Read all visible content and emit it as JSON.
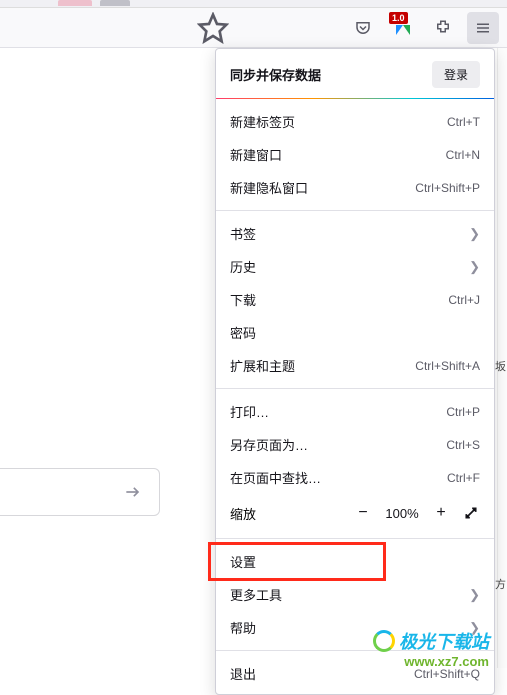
{
  "toolbar": {
    "badge_text": "1.0"
  },
  "menu": {
    "sync_title": "同步并保存数据",
    "login_label": "登录",
    "new_tab": {
      "label": "新建标签页",
      "shortcut": "Ctrl+T"
    },
    "new_window": {
      "label": "新建窗口",
      "shortcut": "Ctrl+N"
    },
    "new_private": {
      "label": "新建隐私窗口",
      "shortcut": "Ctrl+Shift+P"
    },
    "bookmarks": {
      "label": "书签"
    },
    "history": {
      "label": "历史"
    },
    "downloads": {
      "label": "下载",
      "shortcut": "Ctrl+J"
    },
    "passwords": {
      "label": "密码"
    },
    "addons": {
      "label": "扩展和主题",
      "shortcut": "Ctrl+Shift+A"
    },
    "print": {
      "label": "打印…",
      "shortcut": "Ctrl+P"
    },
    "save_as": {
      "label": "另存页面为…",
      "shortcut": "Ctrl+S"
    },
    "find": {
      "label": "在页面中查找…",
      "shortcut": "Ctrl+F"
    },
    "zoom": {
      "label": "缩放",
      "value": "100%"
    },
    "settings": {
      "label": "设置"
    },
    "more_tools": {
      "label": "更多工具"
    },
    "help": {
      "label": "帮助"
    },
    "quit": {
      "label": "退出",
      "shortcut": "Ctrl+Shift+Q"
    }
  },
  "edge": {
    "c1": "方",
    "c2": "坂"
  },
  "watermark": {
    "name": "极光下载站",
    "url": "www.xz7.com"
  },
  "highlight": {
    "target": "设置"
  }
}
